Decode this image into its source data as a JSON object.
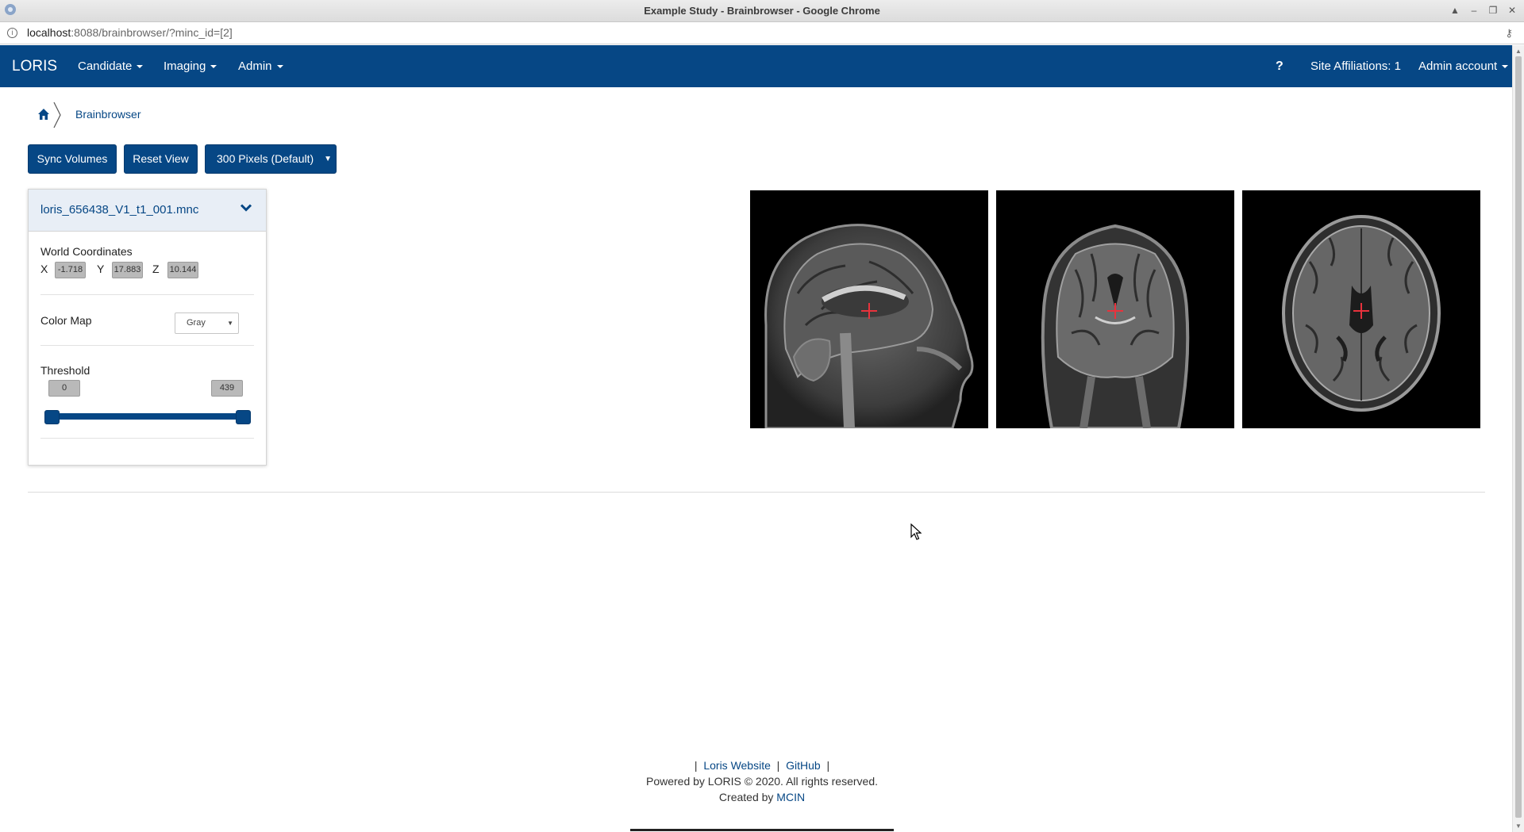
{
  "window": {
    "title": "Example Study - Brainbrowser - Google Chrome",
    "url_host": "localhost",
    "url_rest": ":8088/brainbrowser/?minc_id=[2]"
  },
  "navbar": {
    "brand": "LORIS",
    "menus": [
      "Candidate",
      "Imaging",
      "Admin"
    ],
    "help": "?",
    "site_affiliations": "Site Affiliations: 1",
    "account": "Admin account"
  },
  "breadcrumb": {
    "current": "Brainbrowser"
  },
  "toolbar": {
    "sync_label": "Sync Volumes",
    "reset_label": "Reset View",
    "size_label": "300 Pixels (Default)"
  },
  "panel": {
    "filename": "loris_656438_V1_t1_001.mnc",
    "world_coords_label": "World Coordinates",
    "x_label": "X",
    "y_label": "Y",
    "z_label": "Z",
    "x_value": "-1.718",
    "y_value": "17.883",
    "z_value": "10.144",
    "color_map_label": "Color Map",
    "color_map_value": "Gray",
    "threshold_label": "Threshold",
    "threshold_min": "0",
    "threshold_max": "439"
  },
  "footer": {
    "sep": "|",
    "loris_website": "Loris Website",
    "github": "GitHub",
    "powered": "Powered by LORIS © 2020. All rights reserved.",
    "created_by": "Created by",
    "mcin": "MCIN"
  },
  "colors": {
    "navbar": "#064785",
    "crosshair": "#e8323c"
  }
}
